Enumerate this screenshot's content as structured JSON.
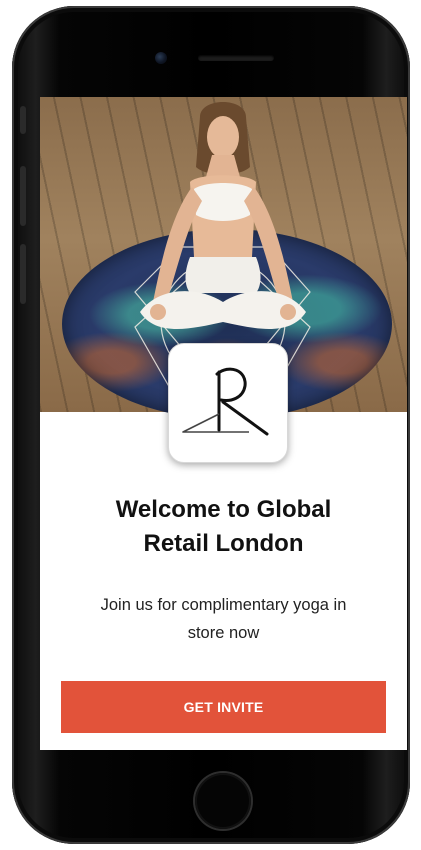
{
  "welcome": {
    "title_line1": "Welcome to Global",
    "title_line2": "Retail London",
    "subtitle_line1": "Join us for complimentary yoga in",
    "subtitle_line2": "store now"
  },
  "cta": {
    "label": "GET INVITE"
  },
  "logo": {
    "letter": "R"
  },
  "colors": {
    "accent": "#e2533a",
    "title": "#111111",
    "body": "#222222"
  },
  "icons": {
    "logo": "hanger-r-logo-icon",
    "home": "home-button-icon",
    "camera": "front-camera-icon"
  }
}
